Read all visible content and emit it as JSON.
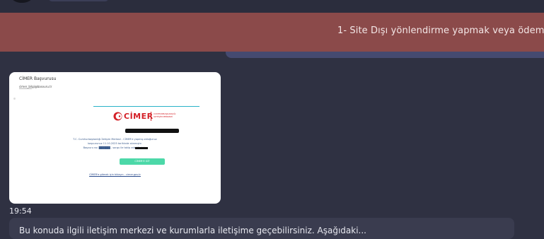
{
  "banner": {
    "text": "1- Site Dışı yönlendirme yapmak veya ödeme"
  },
  "message": {
    "timestamp": "19:54",
    "thumbnail": {
      "subject": "CİMER Başvurusu",
      "sender": "cimer_bilgi@basvuru.tr",
      "brand": "CİMER",
      "brand_subtitle": "CUMHURBAŞKANLIĞI İLETİŞİM MERKEZİ",
      "body_line_1": "T.C. Cumhurbaşkanlığı İletişim Merkezi - CİMER'e yapmış olduğunuz",
      "body_line_2": "başvurunuz 11.10.2025 tarihinde alınmıştır.",
      "body_line_3": "Başvuru no: ██████ - sorgu ile takip edebilirsiniz.",
      "button_label": "CİMER'E GİT",
      "footer_link": "CİMER'e gitmek için tıklayın - cimer.gov.tr"
    }
  },
  "next_message": {
    "text": "Bu konuda ilgili iletişim merkezi ve kurumlarla iletişime geçebilirsiniz. Aşağıdaki..."
  }
}
